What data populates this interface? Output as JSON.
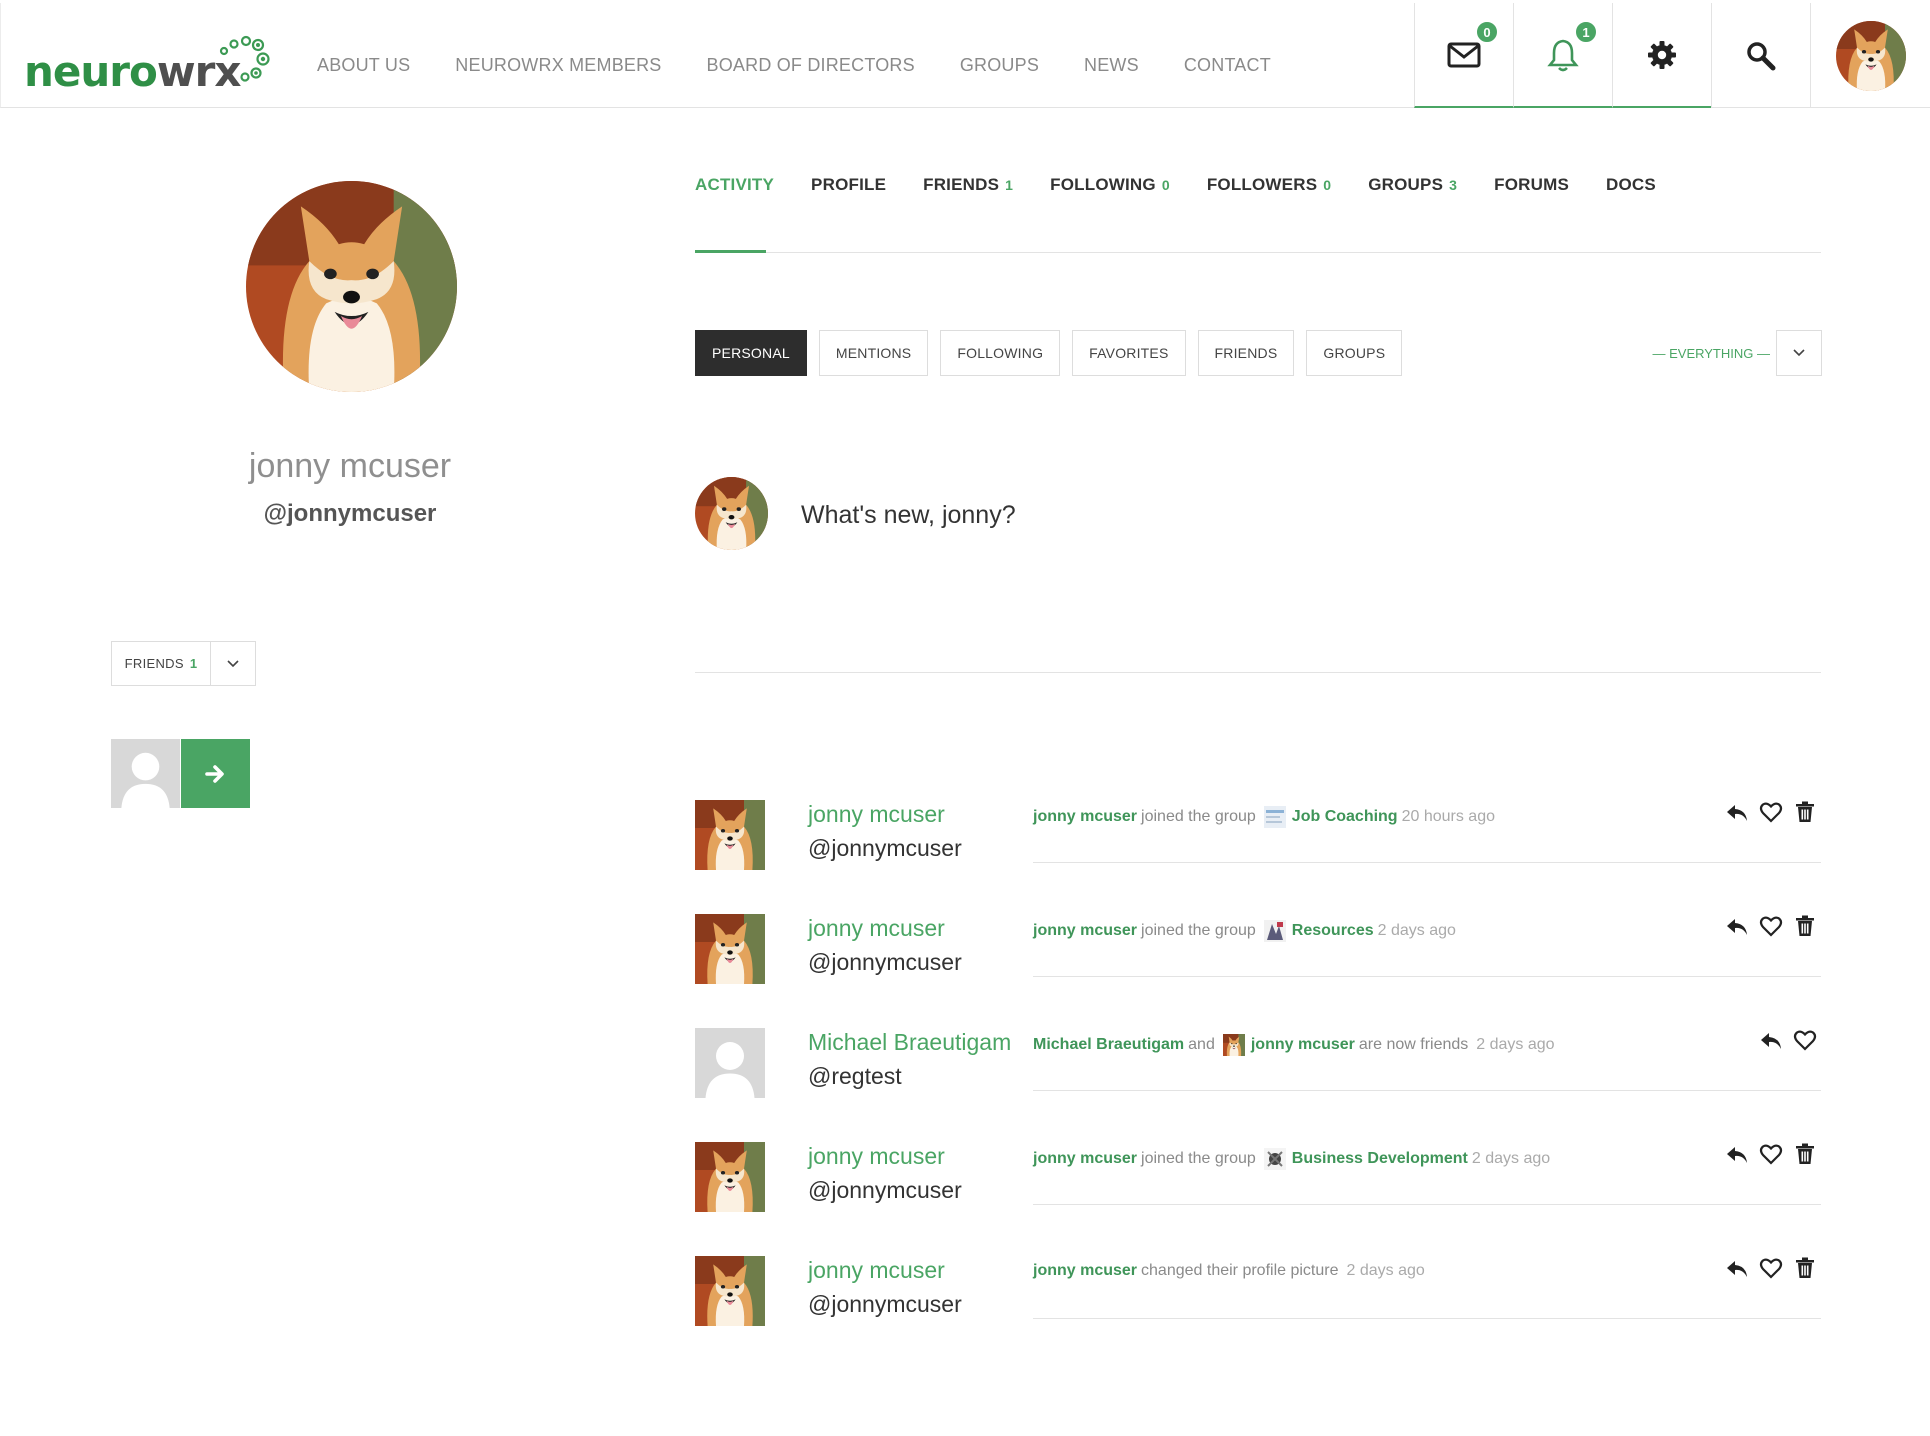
{
  "header": {
    "logo_text_a": "neuro",
    "logo_text_b": "wrx",
    "nav": [
      "ABOUT US",
      "NEUROWRX MEMBERS",
      "BOARD OF DIRECTORS",
      "GROUPS",
      "NEWS",
      "CONTACT"
    ],
    "messages_count": "0",
    "notifications_count": "1",
    "icons": [
      "mail-icon",
      "bell-icon",
      "gear-icon",
      "search-icon",
      "user-avatar"
    ]
  },
  "profile": {
    "name": "jonny mcuser",
    "handle": "@jonnymcuser",
    "friends_label": "FRIENDS",
    "friends_count": "1"
  },
  "tabs": [
    {
      "label": "ACTIVITY",
      "count": ""
    },
    {
      "label": "PROFILE",
      "count": ""
    },
    {
      "label": "FRIENDS",
      "count": "1"
    },
    {
      "label": "FOLLOWING",
      "count": "0"
    },
    {
      "label": "FOLLOWERS",
      "count": "0"
    },
    {
      "label": "GROUPS",
      "count": "3"
    },
    {
      "label": "FORUMS",
      "count": ""
    },
    {
      "label": "DOCS",
      "count": ""
    }
  ],
  "filters": [
    "PERSONAL",
    "MENTIONS",
    "FOLLOWING",
    "FAVORITES",
    "FRIENDS",
    "GROUPS"
  ],
  "show_filter": "— EVERYTHING —",
  "whats_new": "What's new, jonny?",
  "activities": [
    {
      "name": "jonny mcuser",
      "handle": "@jonnymcuser",
      "actor": "jonny mcuser",
      "verb": "joined the group",
      "target": "Job Coaching",
      "time": "20 hours ago"
    },
    {
      "name": "jonny mcuser",
      "handle": "@jonnymcuser",
      "actor": "jonny mcuser",
      "verb": "joined the group",
      "target": "Resources",
      "time": "2 days ago"
    },
    {
      "name": "Michael Braeutigam",
      "handle": "@regtest",
      "actor": "Michael Braeutigam",
      "and": "and",
      "target": "jonny mcuser",
      "verb": "are now friends",
      "time": "2 days ago"
    },
    {
      "name": "jonny mcuser",
      "handle": "@jonnymcuser",
      "actor": "jonny mcuser",
      "verb": "joined the group",
      "target": "Business Development",
      "time": "2 days ago"
    },
    {
      "name": "jonny mcuser",
      "handle": "@jonnymcuser",
      "actor": "jonny mcuser",
      "verb": "changed their profile picture",
      "target": "",
      "time": "2 days ago"
    }
  ],
  "colors": {
    "accent": "#4aa564",
    "dark": "#2d2d2d",
    "muted": "#8a8a8a"
  }
}
